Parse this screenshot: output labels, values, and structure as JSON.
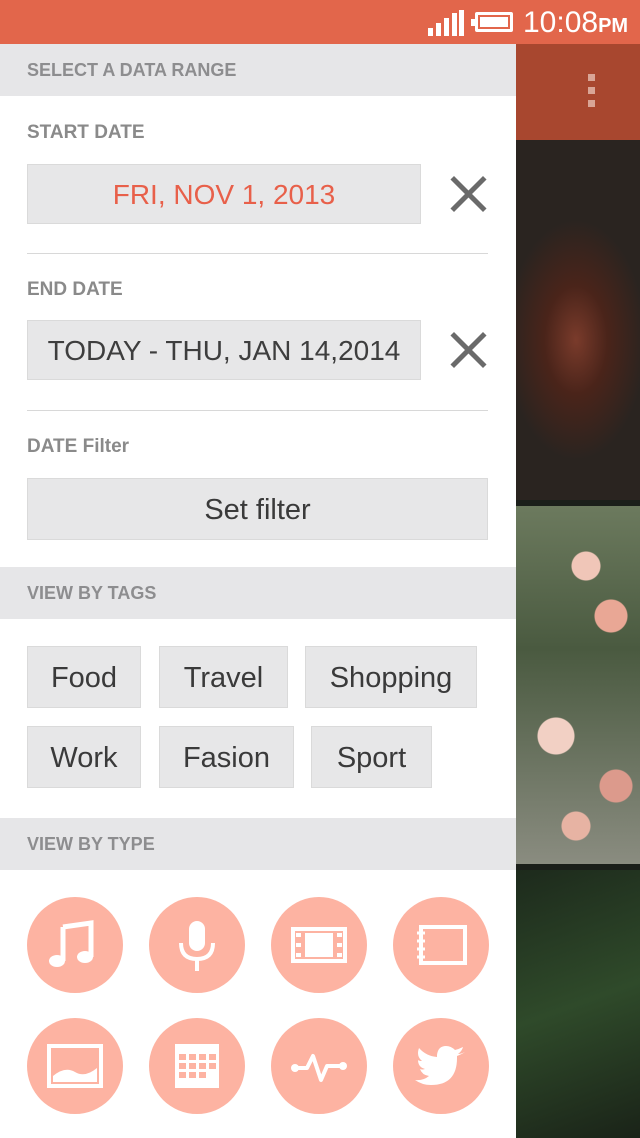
{
  "status_bar": {
    "time": "10:08",
    "ampm": "PM"
  },
  "drawer": {
    "date_range_header": "SELECT A DATA RANGE",
    "start_date_label": "START DATE",
    "start_date_value": "FRI, NOV 1, 2013",
    "end_date_label": "END DATE",
    "end_date_value": "TODAY - THU, JAN 14,2014",
    "date_filter_label": "DATE Filter",
    "set_filter_label": "Set filter",
    "tags_header": "VIEW BY TAGS",
    "tags": [
      "Food",
      "Travel",
      "Shopping",
      "Work",
      "Fasion",
      "Sport"
    ],
    "type_header": "VIEW BY TYPE",
    "types": [
      "music-icon",
      "microphone-icon",
      "video-icon",
      "notebook-icon",
      "picture-icon",
      "calendar-icon",
      "activity-icon",
      "twitter-icon"
    ]
  },
  "colors": {
    "accent": "#e2664b",
    "start_date_text": "#e8604a",
    "type_button_bg": "#fdb3a2"
  }
}
